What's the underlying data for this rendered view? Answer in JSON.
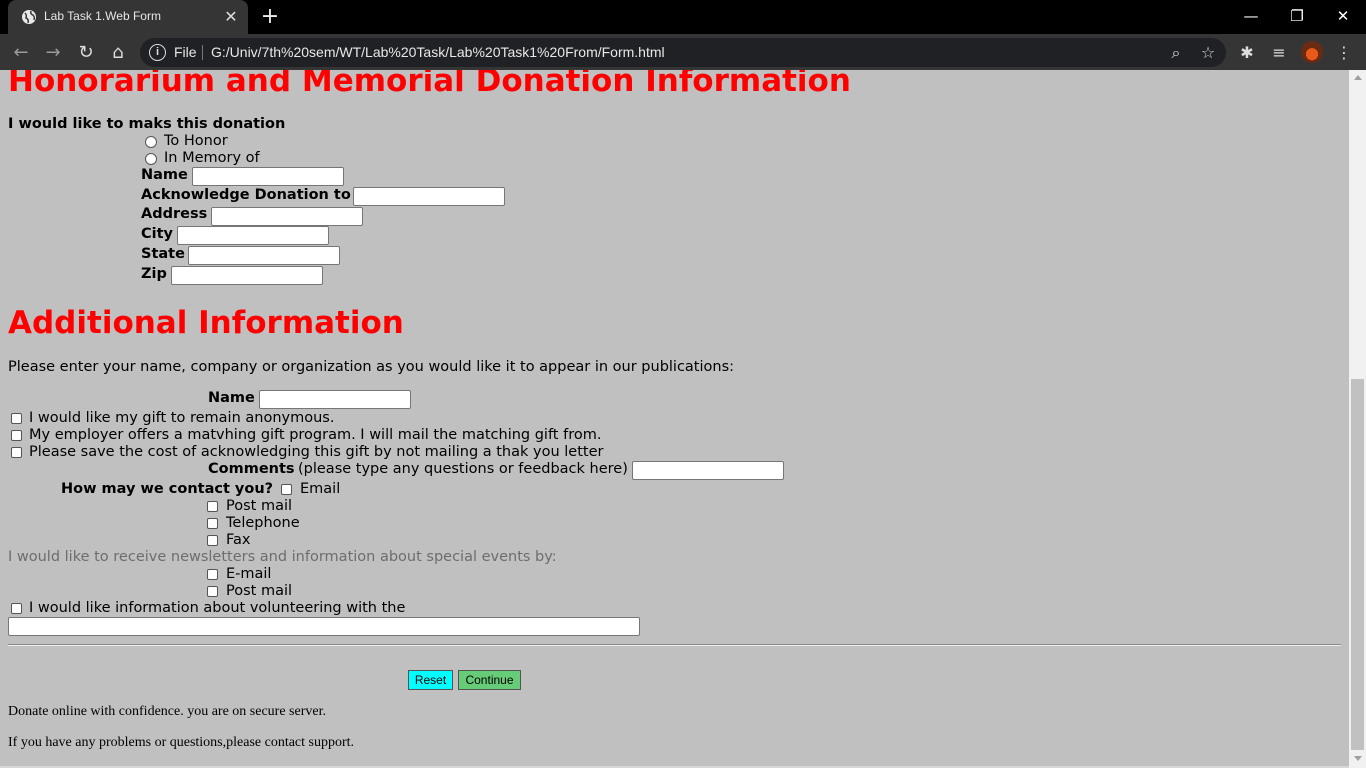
{
  "browser": {
    "tab_title": "Lab Task 1.Web Form",
    "scheme": "File",
    "url": "G:/Univ/7th%20sem/WT/Lab%20Task/Lab%20Task1%20From/Form.html"
  },
  "honor": {
    "heading": "Honorarium and Memorial Donation Information",
    "question": "I would like to maks this donation",
    "options": [
      "To Honor",
      "In Memory of"
    ],
    "fields": [
      "Name",
      "Acknowledge Donation to",
      "Address",
      "City",
      "State",
      "Zip"
    ]
  },
  "additional": {
    "heading": "Additional Information",
    "instruction": "Please enter your name, company or organization as you would like it to appear in our publications:",
    "name_label": "Name",
    "checks": [
      "I would like my gift to remain anonymous.",
      "My employer offers a matvhing gift program. I will mail the matching gift from.",
      "Please save the cost of acknowledging this gift by not mailing a thak you letter"
    ],
    "comments_label": "Comments",
    "comments_hint": "(please type any questions or feedback here)",
    "contact_label": "How may we contact you?",
    "contact_options": [
      "Email",
      "Post mail",
      "Telephone",
      "Fax"
    ],
    "newsletter_text": "I would like to receive newsletters and information about special events by:",
    "newsletter_options": [
      "E-mail",
      "Post mail"
    ],
    "volunteer_text": "I would like information about volunteering with the"
  },
  "buttons": {
    "reset": "Reset",
    "continue": "Continue",
    "reset_color": "#00ffff",
    "continue_color": "#66cc77"
  },
  "footer": {
    "secure_note": "Donate online with confidence. you are on secure server.",
    "support_note": "If you have any problems or questions,please contact support."
  }
}
